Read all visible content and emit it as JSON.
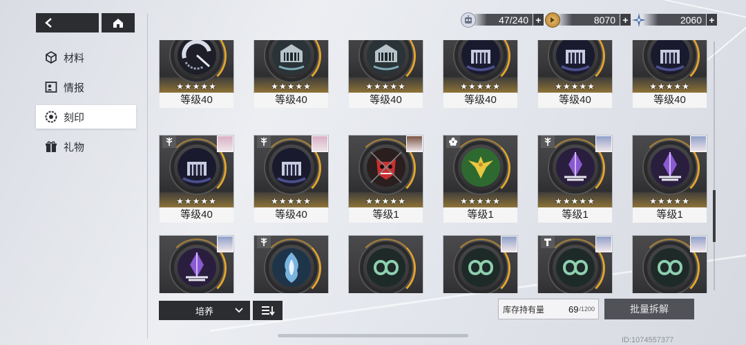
{
  "nav": {
    "back_icon": "arrow-left-icon",
    "home_icon": "home-icon"
  },
  "sidebar": {
    "items": [
      {
        "label": "材料",
        "icon": "cube-icon",
        "active": false
      },
      {
        "label": "情报",
        "icon": "profile-card-icon",
        "active": false
      },
      {
        "label": "刻印",
        "icon": "gear-eye-icon",
        "active": true
      },
      {
        "label": "礼物",
        "icon": "gift-icon",
        "active": false
      }
    ]
  },
  "resources": {
    "storage": {
      "value": "47/240",
      "icon": "robot-head-icon"
    },
    "coins": {
      "value": "8070",
      "icon": "gold-coin-icon"
    },
    "stars": {
      "value": "2060",
      "icon": "blue-star-icon"
    },
    "plus": "+"
  },
  "cards": [
    {
      "level": "等级40",
      "stars": "★★★★★",
      "type": "flower",
      "emblem": "white-crescent",
      "portrait": "#b07a86"
    },
    {
      "level": "等级40",
      "stars": "★★★★★",
      "type": "tower",
      "emblem": "silver-fortress",
      "portrait": "#8fa0c8"
    },
    {
      "level": "等级40",
      "stars": "★★★★★",
      "type": "tower",
      "emblem": "silver-fortress",
      "portrait": "#8fa0c8"
    },
    {
      "level": "等级40",
      "stars": "★★★★★",
      "type": "tree",
      "emblem": "dark-fortress",
      "portrait": "#d6b4c8"
    },
    {
      "level": "等级40",
      "stars": "★★★★★",
      "type": "tree",
      "emblem": "dark-fortress",
      "portrait": "#9eb2d8"
    },
    {
      "level": "等级40",
      "stars": "★★★★★",
      "type": "tree",
      "emblem": "dark-fortress",
      "portrait": "#9eb2d8"
    },
    {
      "level": "等级40",
      "stars": "★★★★★",
      "type": "tree",
      "emblem": "dark-fortress",
      "portrait": "#d8b0c4"
    },
    {
      "level": "等级40",
      "stars": "★★★★★",
      "type": "tree",
      "emblem": "dark-fortress",
      "portrait": "#d8b0c4"
    },
    {
      "level": "等级1",
      "stars": "★★★★★",
      "type": "none",
      "emblem": "red-oni-mask",
      "portrait": "#7a5646"
    },
    {
      "level": "等级1",
      "stars": "★★★★★",
      "type": "flower",
      "emblem": "golden-phoenix",
      "portrait": ""
    },
    {
      "level": "等级1",
      "stars": "★★★★★",
      "type": "tree",
      "emblem": "purple-crystal",
      "portrait": "#8fa0c8"
    },
    {
      "level": "等级1",
      "stars": "★★★★★",
      "type": "none",
      "emblem": "purple-crystal",
      "portrait": "#8fa0c8"
    },
    {
      "level": "",
      "stars": "",
      "type": "none",
      "emblem": "purple-crystal",
      "portrait": "#8fa0c8"
    },
    {
      "level": "",
      "stars": "",
      "type": "tree2",
      "emblem": "blue-flame",
      "portrait": ""
    },
    {
      "level": "",
      "stars": "",
      "type": "none",
      "emblem": "jade-serpent",
      "portrait": ""
    },
    {
      "level": "",
      "stars": "",
      "type": "none",
      "emblem": "jade-serpent",
      "portrait": "#8fa0c8"
    },
    {
      "level": "",
      "stars": "",
      "type": "tower",
      "emblem": "jade-serpent",
      "portrait": "#8fa0c8"
    },
    {
      "level": "",
      "stars": "",
      "type": "none",
      "emblem": "jade-serpent",
      "portrait": "#8fa0c8"
    }
  ],
  "footer": {
    "filter_label": "培养",
    "sort_icon": "sort-list-icon",
    "inventory_label": "库存持有量",
    "inventory_count": "69",
    "inventory_max": "/1200",
    "dismantle_label": "批量拆解",
    "uid": "ID:1074557377"
  },
  "colors": {
    "dark_button": "#2b2d31",
    "gold_ring": "#e5a52a",
    "card_bg": "#3a3a3c"
  }
}
